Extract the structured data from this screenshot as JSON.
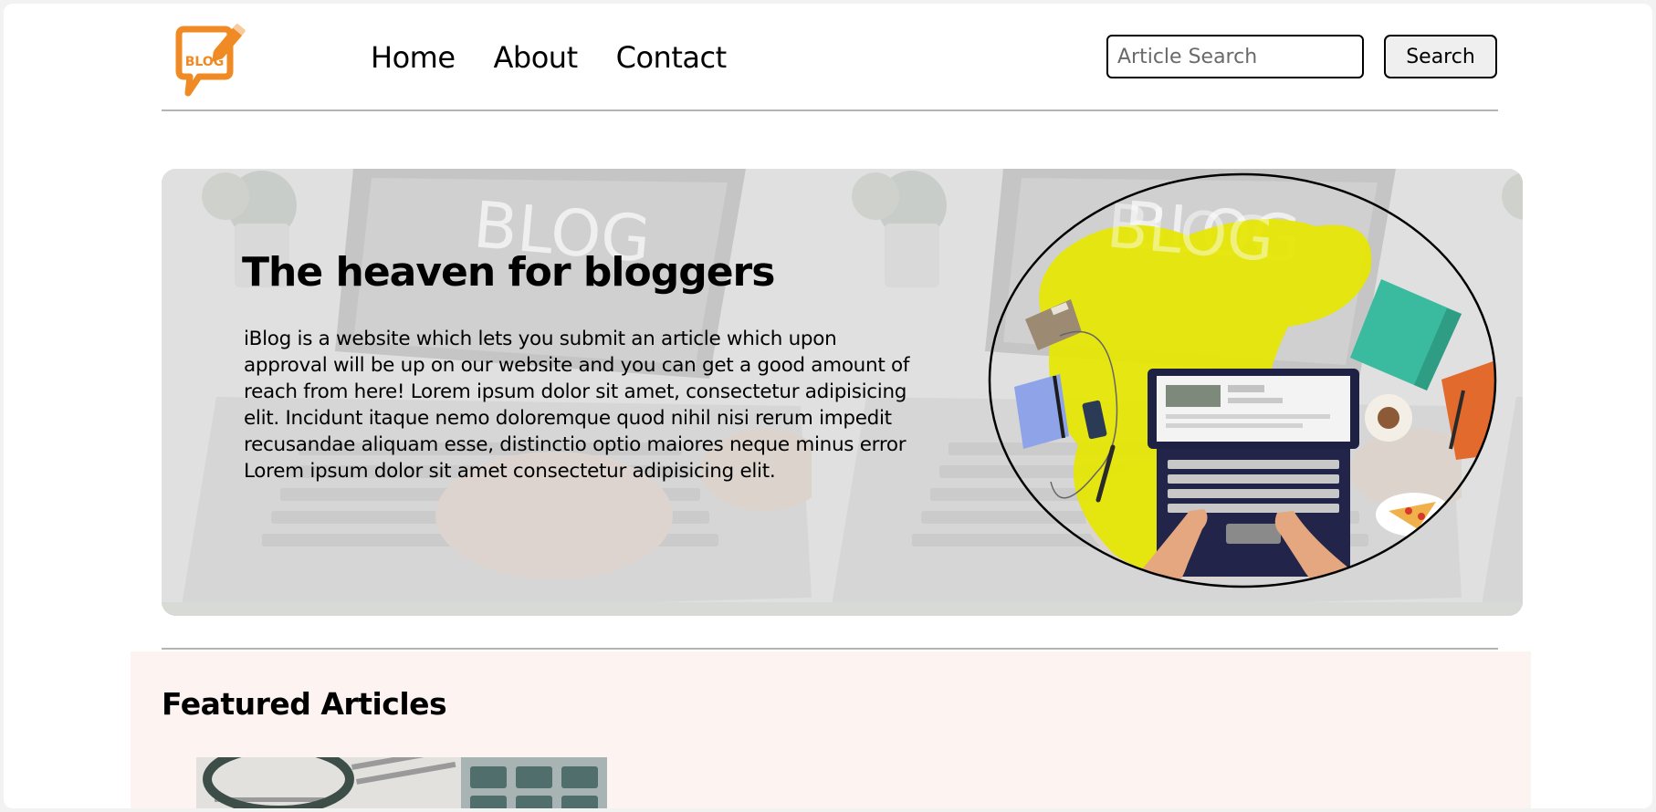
{
  "header": {
    "logo_text": "BLOG",
    "nav": [
      "Home",
      "About",
      "Contact"
    ],
    "search_placeholder": "Article Search",
    "search_button": "Search"
  },
  "hero": {
    "title": "The heaven for bloggers",
    "description": "iBlog is a website which lets you submit an article which upon approval will be up on our website and you can get a good amount of reach from here! Lorem ipsum dolor sit amet, consectetur adipisicing elit. Incidunt itaque nemo doloremque quod nihil nisi rerum impedit recusandae aliquam esse, distinctio optio maiores neque minus error Lorem ipsum dolor sit amet consectetur adipisicing elit.",
    "background_text": "BLOG"
  },
  "featured": {
    "title": "Featured Articles"
  },
  "colors": {
    "accent_orange": "#f08a24",
    "illustration_yellow": "#e5e600",
    "featured_bg": "#fdf3f1"
  }
}
